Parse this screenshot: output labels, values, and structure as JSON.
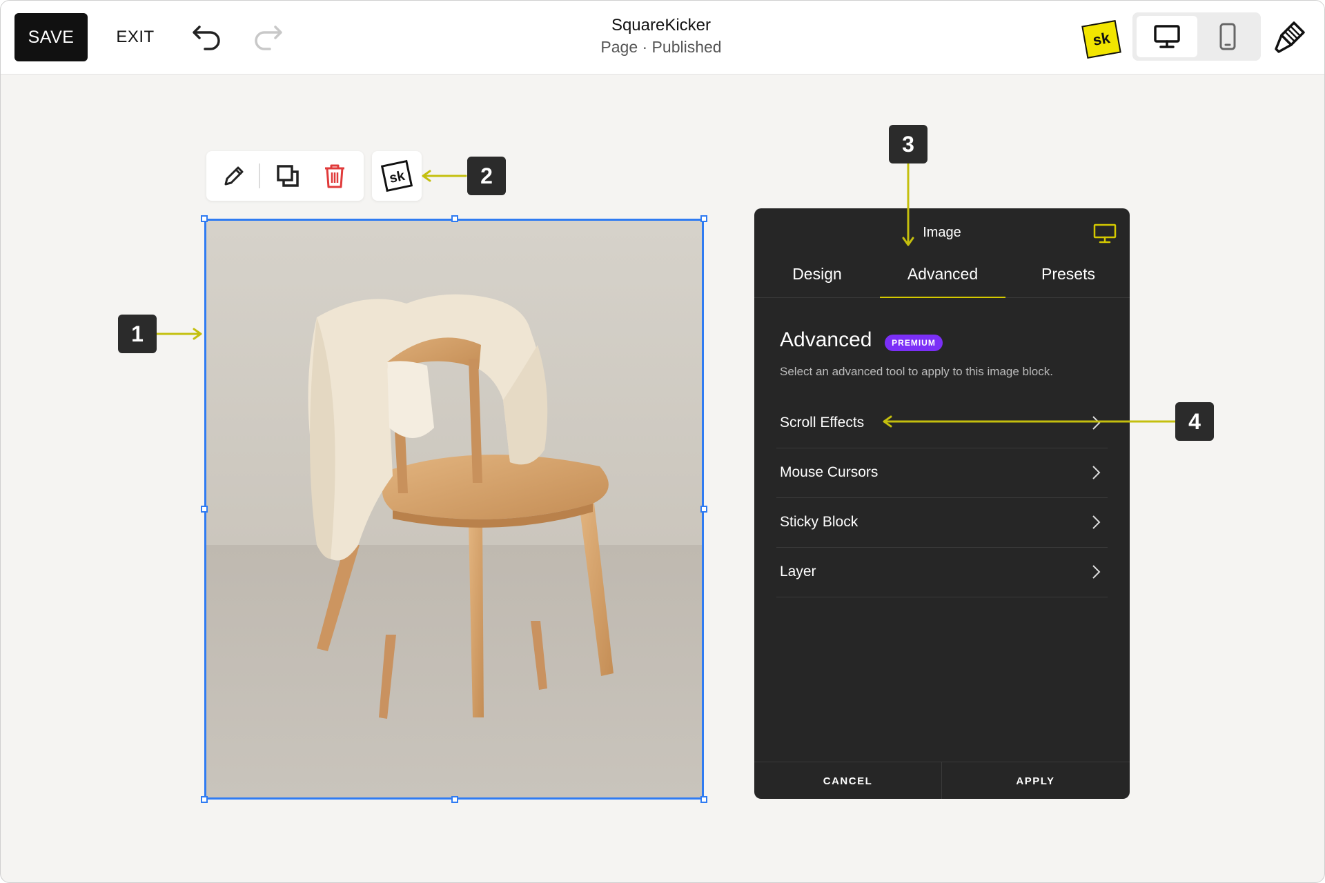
{
  "topbar": {
    "save_label": "SAVE",
    "exit_label": "EXIT",
    "title": "SquareKicker",
    "subtitle": "Page · Published",
    "logo_text": "sk"
  },
  "block_toolbar": {
    "tools": [
      "pencil-icon",
      "duplicate-icon",
      "trash-icon"
    ],
    "sk_tool_text": "sk"
  },
  "image": {
    "description_icon": "photo-of-chair-with-jacket"
  },
  "callouts": [
    "1",
    "2",
    "3",
    "4"
  ],
  "panel": {
    "header": "Image",
    "tabs": [
      {
        "label": "Design",
        "active": false
      },
      {
        "label": "Advanced",
        "active": true
      },
      {
        "label": "Presets",
        "active": false
      }
    ],
    "section_title": "Advanced",
    "badge": "PREMIUM",
    "description": "Select an advanced tool to apply to this image block.",
    "items": [
      {
        "label": "Scroll Effects"
      },
      {
        "label": "Mouse Cursors"
      },
      {
        "label": "Sticky Block"
      },
      {
        "label": "Layer"
      }
    ],
    "footer": {
      "cancel": "CANCEL",
      "apply": "APPLY"
    }
  },
  "colors": {
    "accent_blue": "#2f7bf2",
    "callout_arrow": "#c4bf0e",
    "panel_bg": "#262626",
    "premium": "#7b2ff7",
    "delete_red": "#e03a3a",
    "sk_yellow": "#f2e500"
  }
}
